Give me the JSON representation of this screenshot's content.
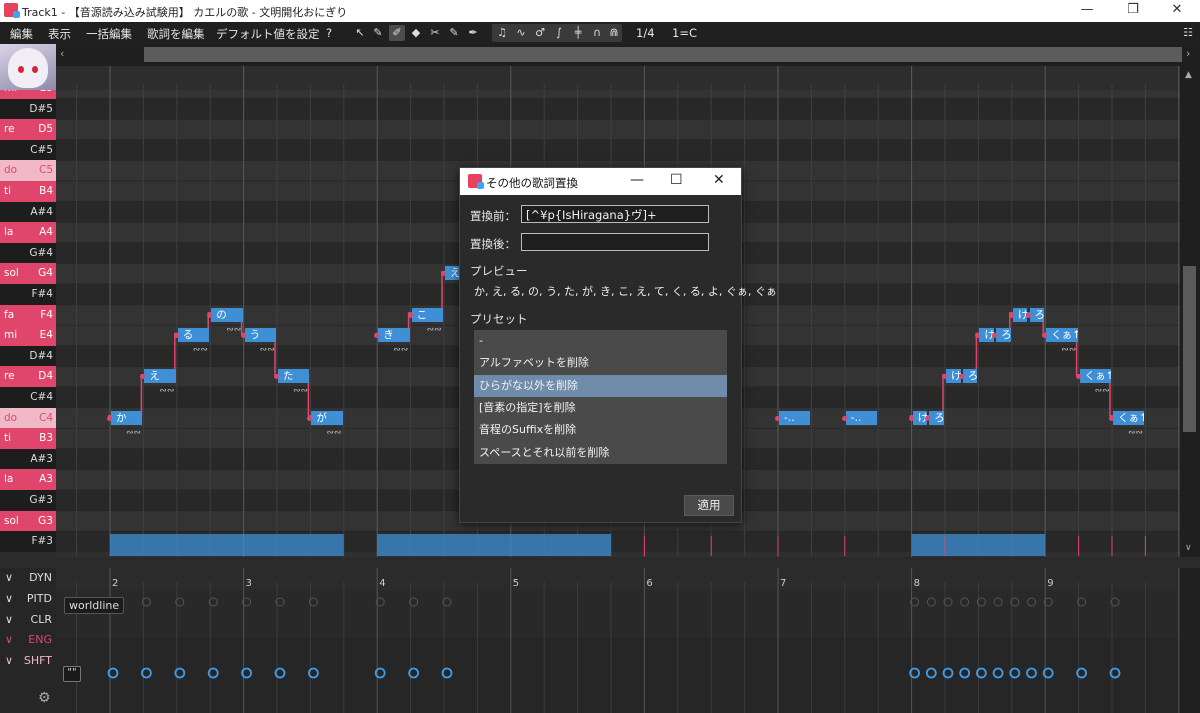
{
  "window": {
    "title": "Track1 - 【音源読み込み試験用】 カエルの歌 - 文明開化おにぎり",
    "minimize": "—",
    "maximize": "❐",
    "close": "✕"
  },
  "menu": {
    "items": [
      "編集",
      "表示",
      "一括編集",
      "歌詞を編集",
      "デフォルト値を設定",
      "?"
    ],
    "snap": "1/4",
    "key": "1=C",
    "tool_icons": [
      "pointer-icon",
      "pencil-icon",
      "line-pencil-icon",
      "eraser-icon",
      "knife-icon",
      "drawline-icon",
      "draw-pitch-icon"
    ],
    "view_icons": [
      "note-icon",
      "vibrato-icon",
      "phoneme-icon",
      "pitch-icon",
      "finalpitch-icon",
      "waveform-icon",
      "curve-icon"
    ]
  },
  "ruler": {
    "bars": [
      "2",
      "3",
      "4",
      "5",
      "6",
      "7",
      "8",
      "9"
    ]
  },
  "piano": {
    "keys": [
      {
        "solf": "mi",
        "label": "E5",
        "kind": "white"
      },
      {
        "solf": "",
        "label": "D#5",
        "kind": "black"
      },
      {
        "solf": "re",
        "label": "D5",
        "kind": "white"
      },
      {
        "solf": "",
        "label": "C#5",
        "kind": "black"
      },
      {
        "solf": "do",
        "label": "C5",
        "kind": "c"
      },
      {
        "solf": "ti",
        "label": "B4",
        "kind": "white"
      },
      {
        "solf": "",
        "label": "A#4",
        "kind": "black"
      },
      {
        "solf": "la",
        "label": "A4",
        "kind": "white"
      },
      {
        "solf": "",
        "label": "G#4",
        "kind": "black"
      },
      {
        "solf": "sol",
        "label": "G4",
        "kind": "white"
      },
      {
        "solf": "",
        "label": "F#4",
        "kind": "black"
      },
      {
        "solf": "fa",
        "label": "F4",
        "kind": "white"
      },
      {
        "solf": "mi",
        "label": "E4",
        "kind": "white"
      },
      {
        "solf": "",
        "label": "D#4",
        "kind": "black"
      },
      {
        "solf": "re",
        "label": "D4",
        "kind": "white"
      },
      {
        "solf": "",
        "label": "C#4",
        "kind": "black"
      },
      {
        "solf": "do",
        "label": "C4",
        "kind": "c"
      },
      {
        "solf": "ti",
        "label": "B3",
        "kind": "white"
      },
      {
        "solf": "",
        "label": "A#3",
        "kind": "black"
      },
      {
        "solf": "la",
        "label": "A3",
        "kind": "white"
      },
      {
        "solf": "",
        "label": "G#3",
        "kind": "black"
      },
      {
        "solf": "sol",
        "label": "G3",
        "kind": "white"
      },
      {
        "solf": "",
        "label": "F#3",
        "kind": "black"
      }
    ]
  },
  "notes": [
    {
      "lyric": "か",
      "bar": 2.0,
      "dur": 0.25,
      "pitch": "C4"
    },
    {
      "lyric": "え",
      "bar": 2.25,
      "dur": 0.25,
      "pitch": "D4"
    },
    {
      "lyric": "る",
      "bar": 2.5,
      "dur": 0.25,
      "pitch": "E4"
    },
    {
      "lyric": "の",
      "bar": 2.75,
      "dur": 0.25,
      "pitch": "F4"
    },
    {
      "lyric": "う",
      "bar": 3.0,
      "dur": 0.25,
      "pitch": "E4"
    },
    {
      "lyric": "た",
      "bar": 3.25,
      "dur": 0.25,
      "pitch": "D4"
    },
    {
      "lyric": "が",
      "bar": 3.5,
      "dur": 0.25,
      "pitch": "C4"
    },
    {
      "lyric": "き",
      "bar": 4.0,
      "dur": 0.25,
      "pitch": "E4"
    },
    {
      "lyric": "こ",
      "bar": 4.25,
      "dur": 0.25,
      "pitch": "F4"
    },
    {
      "lyric": "え",
      "bar": 4.5,
      "dur": 0.25,
      "pitch": "G4"
    },
    {
      "lyric": "-..",
      "bar": 7.0,
      "dur": 0.25,
      "pitch": "C4"
    },
    {
      "lyric": "-..",
      "bar": 7.5,
      "dur": 0.25,
      "pitch": "C4"
    },
    {
      "lyric": "け",
      "bar": 8.0,
      "dur": 0.125,
      "pitch": "C4"
    },
    {
      "lyric": "ろ",
      "bar": 8.125,
      "dur": 0.125,
      "pitch": "C4"
    },
    {
      "lyric": "け",
      "bar": 8.25,
      "dur": 0.125,
      "pitch": "D4"
    },
    {
      "lyric": "ろ",
      "bar": 8.375,
      "dur": 0.125,
      "pitch": "D4"
    },
    {
      "lyric": "け",
      "bar": 8.5,
      "dur": 0.125,
      "pitch": "E4"
    },
    {
      "lyric": "ろ",
      "bar": 8.625,
      "dur": 0.125,
      "pitch": "E4"
    },
    {
      "lyric": "け",
      "bar": 8.75,
      "dur": 0.125,
      "pitch": "F4"
    },
    {
      "lyric": "ろ",
      "bar": 8.875,
      "dur": 0.125,
      "pitch": "F4"
    },
    {
      "lyric": "くぁ↑",
      "bar": 9.0,
      "dur": 0.25,
      "pitch": "E4"
    },
    {
      "lyric": "くぁ↑",
      "bar": 9.25,
      "dur": 0.25,
      "pitch": "D4"
    },
    {
      "lyric": "くぁ↑",
      "bar": 9.5,
      "dur": 0.25,
      "pitch": "C4"
    }
  ],
  "expressions": [
    {
      "chev": "∨",
      "name": "DYN",
      "color": "#dddddd"
    },
    {
      "chev": "∨",
      "name": "PITD",
      "color": "#dddddd"
    },
    {
      "chev": "∨",
      "name": "CLR",
      "color": "#dddddd"
    },
    {
      "chev": "∨",
      "name": "ENG",
      "color": "#e0466b"
    },
    {
      "chev": "∨",
      "name": "SHFT",
      "color": "#f1b9c7"
    }
  ],
  "worldline_tag": "worldline",
  "quote_btn": "\"\"",
  "gear": "⚙",
  "dialog": {
    "title": "その他の歌詞置換",
    "minimize": "—",
    "maximize": "☐",
    "close": "✕",
    "before_label": "置換前：",
    "before_value": "[^¥p{IsHiragana}ヴ]+",
    "after_label": "置換後：",
    "after_value": "",
    "preview_label": "プレビュー",
    "preview_text": "か, え, る, の, う, た, が, き, こ, え, て, く, る, よ, ぐぁ, ぐぁ",
    "preset_label": "プリセット",
    "presets": [
      "-",
      "アルファベットを削除",
      "ひらがな以外を削除",
      "[音素の指定]を削除",
      "音程のSuffixを削除",
      "スペースとそれ以前を削除"
    ],
    "selected_preset": 2,
    "apply": "適用"
  },
  "colors": {
    "accent": "#e0466b",
    "note": "#3e8fd6",
    "selection": "#6f8cab"
  }
}
